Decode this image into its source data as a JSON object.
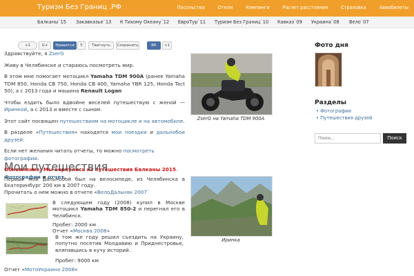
{
  "header": {
    "brand": "Туризм Без Границ .РФ",
    "nav": [
      "Посольства",
      "Отели",
      "Кемпинги",
      "Расчет расстояния",
      "Страховка",
      "Авиабилеты"
    ]
  },
  "categories": [
    "Балканы`15",
    "Закавказье`13",
    "К Тихому Океану`12",
    "ЕвроТур`11",
    "Туризм Без Границ`10",
    "Кавказ`09",
    "Украина`08",
    "Вело`07"
  ],
  "social": {
    "b1": "+1",
    "b2": "G+",
    "like": "Нравится",
    "like_count": "5",
    "tweet": "Твитнуть",
    "save": "Сохранить",
    "vk": "ВК",
    "plus": "+1"
  },
  "main": {
    "greet_a": "Здравствуйте, я ",
    "greet_link": "ZserG",
    "p2": "Живу в Челябинске и стараюсь посмотреть мир.",
    "p3_a": "В этом мне помогает мотоцикл ",
    "p3_bold": "Yamaha TDM 900A",
    "p3_b": " (ранее Yamaha TDM 850, Honda CB 750, Honda CB 400, Yamaha YBR 125, Honda Tact 50), а с 2013 года и машина ",
    "p3_bold2": "Renault Logan",
    "p4_a": "Чтобы ездить было вдвойне веселей путешествую с женой — ",
    "p4_link": "Иринкой",
    "p4_b": ", а с 2013 и вместе с сыном.",
    "p5_a": "Этот сайт посвящен ",
    "p5_link": "путешествиям на мотоцикле и на автомобиле",
    "p5_b": ".",
    "p6_a": "В разделе «",
    "p6_link1": "Путешествия",
    "p6_b": "» находятся ",
    "p6_link2": "мои поездки",
    "p6_c": " и ",
    "p6_link3": "дальнобои друзей",
    "p6_d": ".",
    "p7_a": "Если нет желания читать отчеты, то можно ",
    "p7_link": "посмотреть фотографии",
    "p7_b": ".",
    "upd_a": "Обновление: Мы вернулись из путешествия Балканы 2015",
    "upd_b": ". ",
    "upd_link1": "Фотографии",
    "upd_c": " и ",
    "upd_link2": "отчет",
    "upd_d": "."
  },
  "photo1_caption": "ZserG на Yamaha TDM 900A",
  "section_title": "Мои путешествия",
  "trips": {
    "t1_a": "Первый мой дальнобой был на велосипеде, из Челябинска в Екатеринбург 200 км в 2007 году.",
    "t1_b": "Прочитать о нем можно в отчете «",
    "t1_link": "ВелоДальняк 2007",
    "t1_c": "`",
    "t2_a": "В следующем году (2008) купил в Москве мотоцикл ",
    "t2_bold": "Yamaha TDM 850-2",
    "t2_b": " и перегнал его в Челябинск.",
    "t2_dist": "Пробег: 2000 км",
    "t2_rep_a": "Отчет «",
    "t2_rep_link": "Москва 2008",
    "t2_rep_b": "»",
    "t3_a": "В том же году решил съездить на Украину, попутно посетив Молдавию и Приднестровье, вляпавшись в кучу историй.",
    "t3_dist": "Пробег: 9000 км",
    "t3_rep_a": "Отчет «",
    "t3_rep_link": "МотоУкраина 2008",
    "t3_rep_b": "»"
  },
  "photo2_caption": "Иринка",
  "sidebar": {
    "photo_title": "Фото дня",
    "sections_title": "Разделы",
    "items": [
      "Фотографии",
      "Путешествия друзей"
    ],
    "search_placeholder": "Поиск...",
    "search_button": "Поиск"
  },
  "colors": {
    "topbar": "#f0a02a",
    "link": "#3a6d97",
    "update": "#cc1010"
  }
}
